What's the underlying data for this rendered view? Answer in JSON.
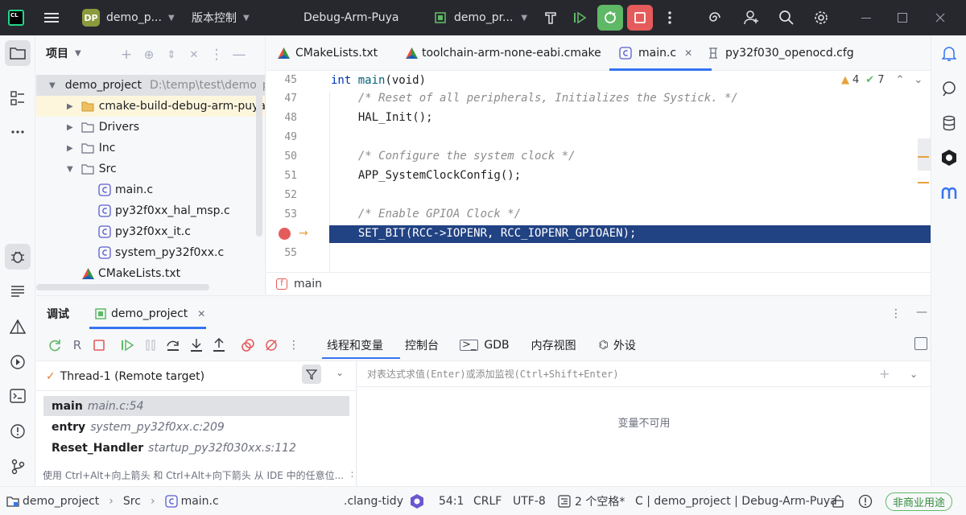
{
  "titlebar": {
    "app_badge": "CL",
    "project_badge": "DP",
    "project_name": "demo_p...",
    "vcs_label": "版本控制",
    "run_config": "Debug-Arm-Puya",
    "target": "demo_pr..."
  },
  "project_panel": {
    "title": "项目",
    "root_name": "demo_project",
    "root_path": "D:\\temp\\test\\demo_p",
    "items": [
      {
        "label": "cmake-build-debug-arm-puya",
        "type": "folder"
      },
      {
        "label": "Drivers",
        "type": "folder"
      },
      {
        "label": "Inc",
        "type": "folder"
      },
      {
        "label": "Src",
        "type": "folder"
      },
      {
        "label": "main.c",
        "type": "c-file"
      },
      {
        "label": "py32f0xx_hal_msp.c",
        "type": "c-file"
      },
      {
        "label": "py32f0xx_it.c",
        "type": "c-file"
      },
      {
        "label": "system_py32f0xx.c",
        "type": "c-file"
      },
      {
        "label": "CMakeLists.txt",
        "type": "cmake-file"
      }
    ]
  },
  "editor": {
    "tabs": [
      {
        "label": "CMakeLists.txt"
      },
      {
        "label": "toolchain-arm-none-eabi.cmake"
      },
      {
        "label": "main.c",
        "active": true
      },
      {
        "label": "py32f030_openocd.cfg"
      }
    ],
    "header_line_no": "45",
    "header_code_kw": "int",
    "header_code_fn": "main",
    "header_code_rest": "(void)",
    "warnings": "4",
    "checks": "7",
    "lines": [
      {
        "no": "47",
        "text": "  /* Reset of all peripherals, Initializes the Systick. */",
        "kind": "comment"
      },
      {
        "no": "48",
        "text": "  HAL_Init();",
        "kind": "code"
      },
      {
        "no": "49",
        "text": "",
        "kind": "code"
      },
      {
        "no": "50",
        "text": "  /* Configure the system clock */",
        "kind": "comment"
      },
      {
        "no": "51",
        "text": "  APP_SystemClockConfig();",
        "kind": "code"
      },
      {
        "no": "52",
        "text": "",
        "kind": "code"
      },
      {
        "no": "53",
        "text": "  /* Enable GPIOA Clock */",
        "kind": "comment"
      },
      {
        "no": "",
        "text": "  SET_BIT(RCC->IOPENR, RCC_IOPENR_GPIOAEN);",
        "kind": "highlight"
      },
      {
        "no": "55",
        "text": "",
        "kind": "code"
      }
    ],
    "breadcrumb_fn": "main",
    "breadcrumb_badge": "f"
  },
  "debug": {
    "title": "调试",
    "session": "demo_project",
    "tabs": [
      "线程和变量",
      "控制台",
      "GDB",
      "内存视图",
      "外设"
    ],
    "thread": "Thread-1 (Remote target)",
    "frames": [
      {
        "fn": "main",
        "loc": "main.c:54"
      },
      {
        "fn": "entry",
        "loc": "system_py32f0xx.c:209"
      },
      {
        "fn": "Reset_Handler",
        "loc": "startup_py32f030xx.s:112"
      }
    ],
    "hint": "使用 Ctrl+Alt+向上箭头 和 Ctrl+Alt+向下箭头 从 IDE 中的任意位...",
    "watch_placeholder": "对表达式求值(Enter)或添加监视(Ctrl+Shift+Enter)",
    "vars_empty": "变量不可用"
  },
  "statusbar": {
    "crumbs": [
      "demo_project",
      "Src",
      "main.c"
    ],
    "clang_tidy": ".clang-tidy",
    "position": "54:1",
    "line_sep": "CRLF",
    "encoding": "UTF-8",
    "indent": "2 个空格*",
    "context": "C | demo_project | Debug-Arm-Puya",
    "license": "非商业用途"
  },
  "colors": {
    "titlebar_bg": "#27282e",
    "run_green": "#5fb865",
    "stop_red": "#e55b5b",
    "selection": "#214283",
    "accent": "#3574f0"
  }
}
